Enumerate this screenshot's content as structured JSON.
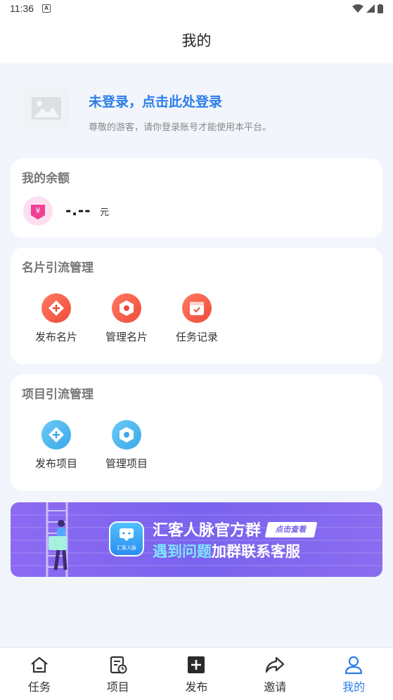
{
  "status_bar": {
    "time": "11:36",
    "notif_icon": "A"
  },
  "header": {
    "title": "我的"
  },
  "profile": {
    "avatar_icon": "image-placeholder-icon",
    "login_prompt": "未登录，点击此处登录",
    "subtitle": "尊敬的游客，请你登录账号才能使用本平台。"
  },
  "balance": {
    "title": "我的余额",
    "icon": "yuan-wallet-icon",
    "value": "-.--",
    "unit": "元"
  },
  "card_management": {
    "title": "名片引流管理",
    "actions": [
      {
        "label": "发布名片",
        "icon": "diamond-plus-icon"
      },
      {
        "label": "管理名片",
        "icon": "hexagon-nut-icon"
      },
      {
        "label": "任务记录",
        "icon": "calendar-check-icon"
      }
    ]
  },
  "project_management": {
    "title": "项目引流管理",
    "actions": [
      {
        "label": "发布项目",
        "icon": "diamond-plus-icon"
      },
      {
        "label": "管理项目",
        "icon": "hexagon-nut-icon"
      }
    ]
  },
  "banner": {
    "app_name": "汇客人脉",
    "title": "汇客人脉官方群",
    "tag": "点击查看",
    "subtitle_highlight": "遇到问题",
    "subtitle_rest": "加群联系客服"
  },
  "tabbar": {
    "tabs": [
      {
        "label": "任务",
        "icon": "home-icon"
      },
      {
        "label": "项目",
        "icon": "document-clock-icon"
      },
      {
        "label": "发布",
        "icon": "plus-square-icon"
      },
      {
        "label": "邀请",
        "icon": "share-icon"
      },
      {
        "label": "我的",
        "icon": "user-icon",
        "active": true
      }
    ]
  },
  "colors": {
    "accent": "#2b7de9",
    "red_icon": "#ee4b3a",
    "blue_icon": "#3aa8ea",
    "banner": "#7a63ee"
  }
}
